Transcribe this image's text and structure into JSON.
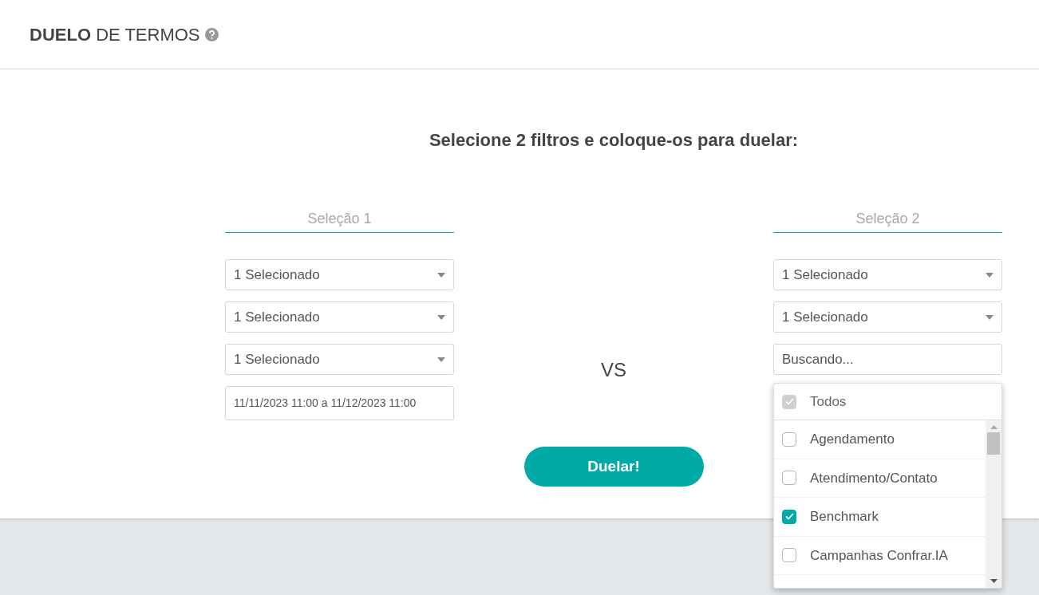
{
  "header": {
    "title_bold": "DUELO",
    "title_rest": "DE TERMOS"
  },
  "heading": "Selecione 2 filtros e coloque-os para duelar:",
  "selections": [
    {
      "label": "Seleção 1",
      "fields": [
        {
          "kind": "select",
          "value": "1 Selecionado"
        },
        {
          "kind": "select",
          "value": "1 Selecionado"
        },
        {
          "kind": "select",
          "value": "1 Selecionado"
        },
        {
          "kind": "text",
          "value": "11/11/2023 11:00 a 11/12/2023 11:00"
        }
      ]
    },
    {
      "label": "Seleção 2",
      "fields": [
        {
          "kind": "select",
          "value": "1 Selecionado"
        },
        {
          "kind": "select",
          "value": "1 Selecionado"
        },
        {
          "kind": "search",
          "placeholder": "Buscando..."
        }
      ],
      "dropdown": {
        "all": {
          "label": "Todos",
          "checked": true,
          "disabled": true
        },
        "options": [
          {
            "label": "Agendamento",
            "checked": false
          },
          {
            "label": "Atendimento/Contato",
            "checked": false
          },
          {
            "label": "Benchmark",
            "checked": true
          },
          {
            "label": "Campanhas Confrar.IA",
            "checked": false
          }
        ]
      }
    }
  ],
  "vs": "VS",
  "button": "Duelar!"
}
